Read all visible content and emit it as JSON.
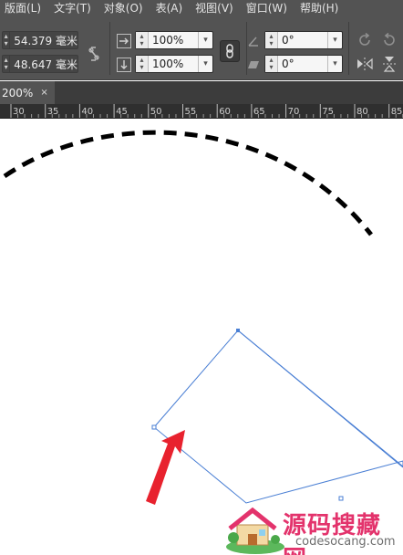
{
  "menu": [
    "版面(L)",
    "文字(T)",
    "对象(O)",
    "表(A)",
    "视图(V)",
    "窗口(W)",
    "帮助(H)"
  ],
  "control": {
    "x_value": "54.379 毫米",
    "y_value": "48.647 毫米",
    "scale_x": "100%",
    "scale_y": "100%",
    "rotate": "0°",
    "shear": "0°"
  },
  "tab": {
    "label": "200%",
    "close": "×"
  },
  "ruler": {
    "ticks": [
      "30",
      "35",
      "40",
      "45",
      "50",
      "55",
      "60",
      "65",
      "70",
      "75",
      "80",
      "85"
    ]
  },
  "watermark": {
    "main": "源码搜藏网",
    "sub": "codesocang.com"
  },
  "colors": {
    "ui_bg": "#535353",
    "selection": "#4a7fd4",
    "arrow": "#e8222e"
  }
}
